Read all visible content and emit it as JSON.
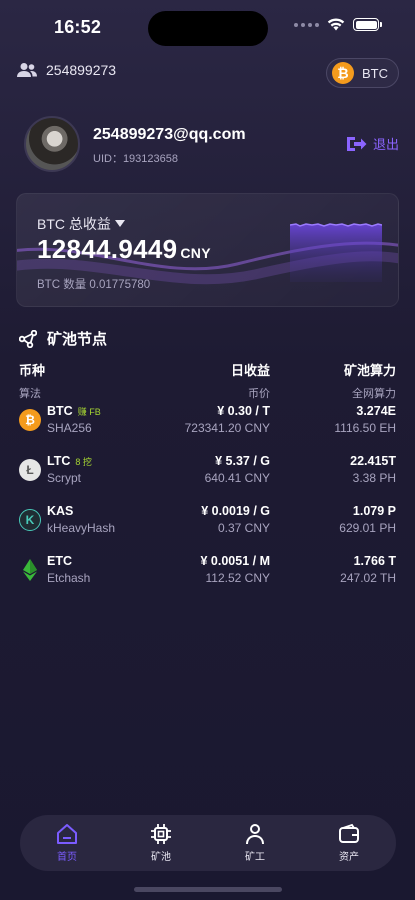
{
  "status": {
    "time": "16:52"
  },
  "header": {
    "user_id": "254899273",
    "coin_label": "BTC"
  },
  "profile": {
    "email": "254899273@qq.com",
    "uid_line": "UID：193123658",
    "logout_label": "退出"
  },
  "earnings": {
    "title": "BTC 总收益",
    "amount": "12844.9449",
    "unit": "CNY",
    "sub": "BTC 数量 0.01775780"
  },
  "pool": {
    "section_title": "矿池节点",
    "headers": {
      "col1_main": "币种",
      "col1_sub": "算法",
      "col2_main": "日收益",
      "col2_sub": "币价",
      "col3_main": "矿池算力",
      "col3_sub": "全网算力"
    },
    "coins": [
      {
        "name": "BTC",
        "tag": "赚 FB",
        "algo": "SHA256",
        "daily": "¥ 0.30 / T",
        "price": "723341.20 CNY",
        "hash": "3.274E",
        "net_hash": "1116.50 EH",
        "icon": "bitcoin-icon",
        "color": "#f49b1d"
      },
      {
        "name": "LTC",
        "tag": "8 挖",
        "algo": "Scrypt",
        "daily": "¥ 5.37 / G",
        "price": "640.41 CNY",
        "hash": "22.415T",
        "net_hash": "3.38 PH",
        "icon": "litecoin-icon",
        "color": "#e6e6e6"
      },
      {
        "name": "KAS",
        "tag": "",
        "algo": "kHeavyHash",
        "daily": "¥ 0.0019 / G",
        "price": "0.37 CNY",
        "hash": "1.079 P",
        "net_hash": "629.01 PH",
        "icon": "kaspa-icon",
        "color": "#49c9b8"
      },
      {
        "name": "ETC",
        "tag": "",
        "algo": "Etchash",
        "daily": "¥ 0.0051 / M",
        "price": "112.52 CNY",
        "hash": "1.766 T",
        "net_hash": "247.02 TH",
        "icon": "ethereum-classic-icon",
        "color": "#3ab83a"
      }
    ]
  },
  "tabs": [
    {
      "label": "首页",
      "icon": "home-icon",
      "active": true
    },
    {
      "label": "矿池",
      "icon": "chip-icon",
      "active": false
    },
    {
      "label": "矿工",
      "icon": "person-icon",
      "active": false
    },
    {
      "label": "资产",
      "icon": "wallet-icon",
      "active": false
    }
  ],
  "colors": {
    "accent": "#7b5cff",
    "background": "#1e1b33",
    "tag_green": "#a5d433"
  }
}
